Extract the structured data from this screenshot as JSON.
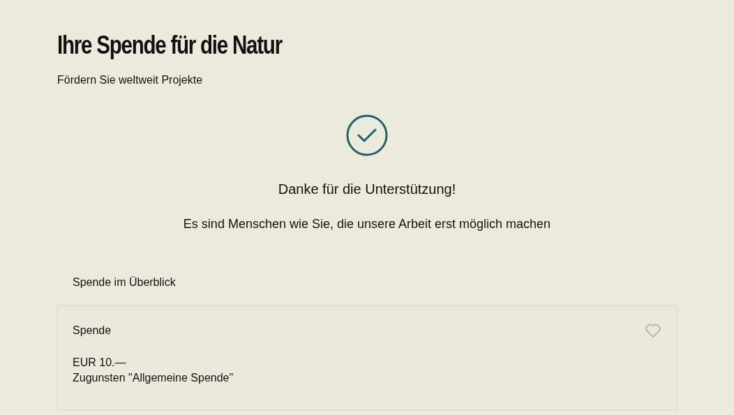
{
  "header": {
    "title": "Ihre Spende für die Natur",
    "subtitle": "Fördern Sie weltweit Projekte"
  },
  "confirmation": {
    "heading": "Danke für die Unterstützung!",
    "message": "Es sind Menschen wie Sie, die unsere Arbeit erst möglich machen"
  },
  "summary": {
    "title": "Spende im Überblick",
    "card": {
      "title": "Spende",
      "favorite": false,
      "lines": [
        "EUR 10.—",
        "Zugunsten \"Allgemeine Spende\""
      ]
    }
  }
}
